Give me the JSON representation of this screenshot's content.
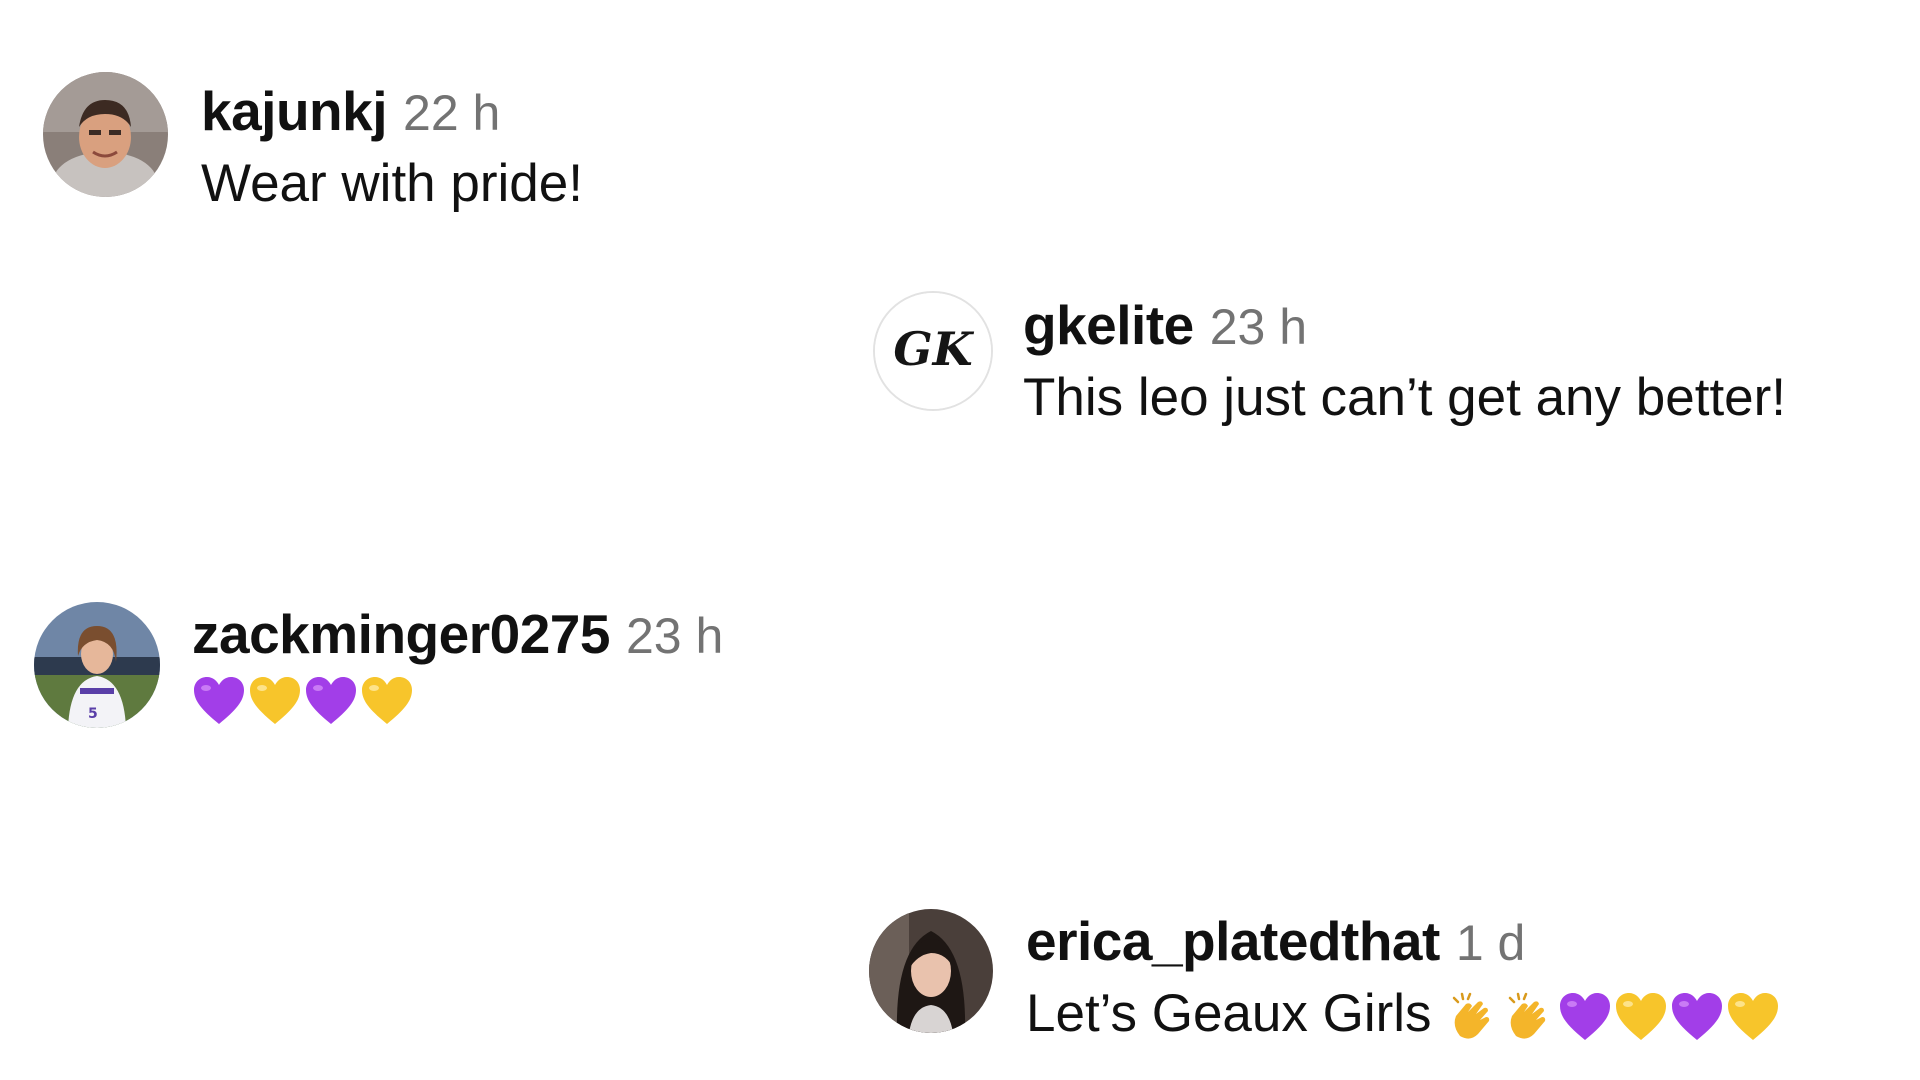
{
  "comments": [
    {
      "username": "kajunkj",
      "time": "22 h",
      "text": "Wear with pride!",
      "avatar_icon": "user-photo-avatar"
    },
    {
      "username": "gkelite",
      "time": "23 h",
      "text": "This leo just can’t get any better!",
      "avatar_icon": "gk-logo-avatar",
      "avatar_logo_text": "GK"
    },
    {
      "username": "zackminger0275",
      "time": "23 h",
      "text": "💜💛💜💛",
      "emojis": [
        "purple-heart",
        "yellow-heart",
        "purple-heart",
        "yellow-heart"
      ],
      "avatar_icon": "user-photo-avatar"
    },
    {
      "username": "erica_platedthat",
      "time": "1 d",
      "text": "Let’s Geaux Girls",
      "text_emoji": "👏👏💜💛💜💛",
      "emojis": [
        "clapping-hands",
        "clapping-hands",
        "purple-heart",
        "yellow-heart",
        "purple-heart",
        "yellow-heart"
      ],
      "avatar_icon": "user-photo-avatar"
    }
  ],
  "colors": {
    "username": "#111111",
    "timestamp": "#737373",
    "purple_heart": "#a23ee8",
    "yellow_heart": "#f7c52b",
    "clap": "#f4b52a"
  }
}
